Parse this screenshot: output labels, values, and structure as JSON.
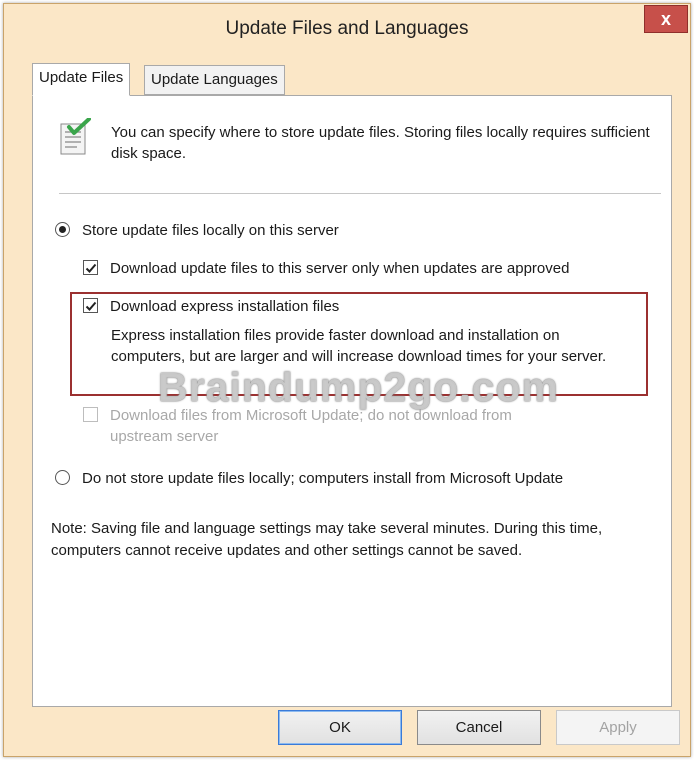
{
  "window": {
    "title": "Update Files and Languages",
    "close_glyph": "x"
  },
  "tabs": [
    {
      "label": "Update Files",
      "active": true
    },
    {
      "label": "Update Languages",
      "active": false
    }
  ],
  "info": {
    "icon": "document-check-icon",
    "text": "You can specify where to store update files. Storing files locally requires sufficient disk space."
  },
  "options": {
    "store_locally": {
      "label": "Store update files locally on this server",
      "selected": true
    },
    "download_when_approved": {
      "label": "Download update files to this server only when updates are approved",
      "checked": true
    },
    "express_files": {
      "label": "Download express installation files",
      "checked": true,
      "description": "Express installation files provide faster download and installation on computers, but are larger and will increase download times for your server."
    },
    "from_microsoft_update": {
      "label_line1": "Download files from Microsoft Update; do not download from",
      "label_line2": "upstream server",
      "checked": false,
      "enabled": false
    },
    "do_not_store": {
      "label": "Do not store update files locally; computers install from Microsoft Update",
      "selected": false
    }
  },
  "note": "Note: Saving file and language settings may take several minutes. During this time, computers cannot receive updates and other settings cannot be saved.",
  "watermark": "Braindump2go.com",
  "buttons": {
    "ok": "OK",
    "cancel": "Cancel",
    "apply": "Apply"
  },
  "colors": {
    "frame": "#fbe7c7",
    "close": "#c7504a",
    "highlight": "#9b3030"
  }
}
